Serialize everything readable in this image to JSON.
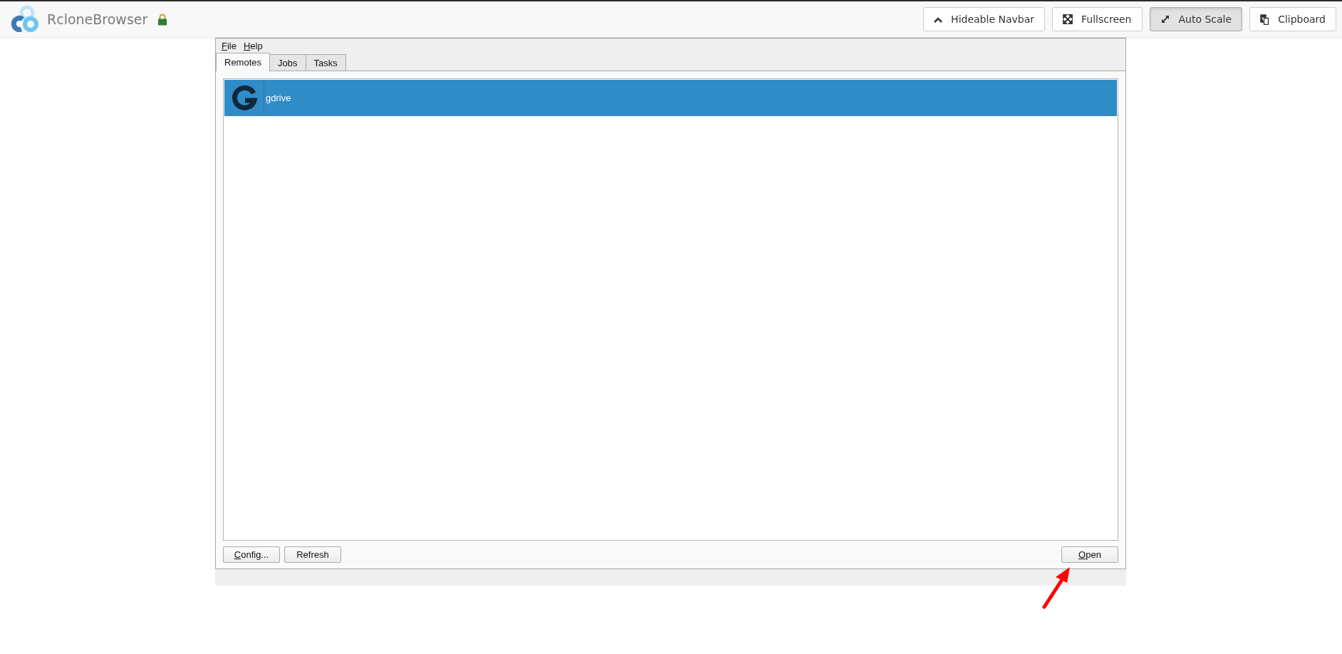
{
  "navbar": {
    "title": "RcloneBrowser",
    "locked": true,
    "buttons": [
      {
        "label": "Hideable Navbar",
        "kind": "chevron",
        "selected": false
      },
      {
        "label": "Fullscreen",
        "kind": "expand",
        "selected": false
      },
      {
        "label": "Auto Scale",
        "kind": "diagonal",
        "selected": true
      },
      {
        "label": "Clipboard",
        "kind": "clipboard",
        "selected": false
      }
    ]
  },
  "app": {
    "menu": [
      {
        "mnemonic": "F",
        "rest": "ile"
      },
      {
        "mnemonic": "H",
        "rest": "elp"
      }
    ],
    "tabs": [
      {
        "label": "Remotes",
        "selected": true
      },
      {
        "label": "Jobs",
        "selected": false
      },
      {
        "label": "Tasks",
        "selected": false
      }
    ],
    "remotes": [
      {
        "name": "gdrive",
        "selected": true
      }
    ],
    "left_buttons": [
      {
        "mnemonic": "C",
        "rest": "onfig..."
      },
      {
        "rest": "Refresh"
      }
    ],
    "right_buttons": [
      {
        "mnemonic": "O",
        "rest": "pen"
      }
    ]
  }
}
